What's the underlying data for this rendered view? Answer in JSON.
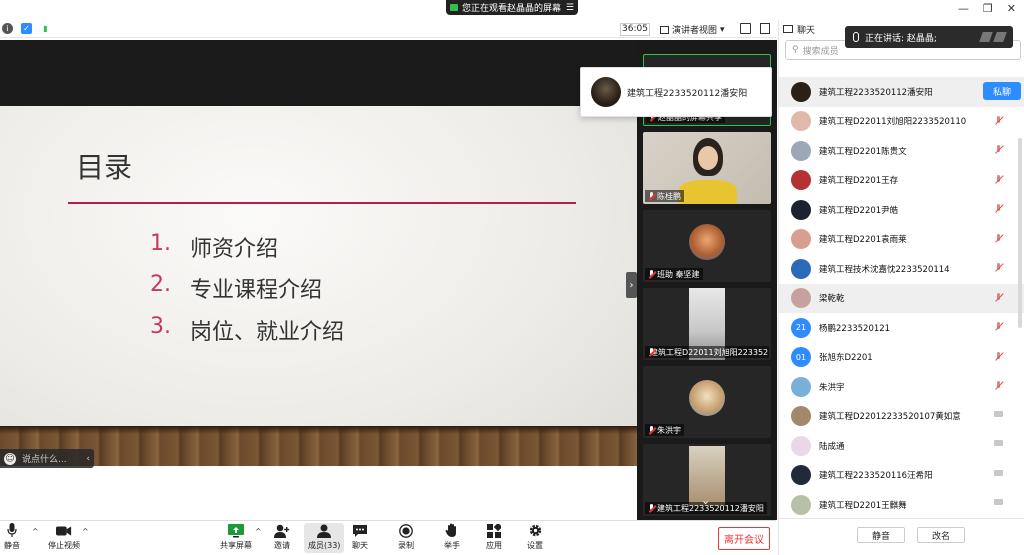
{
  "window": {
    "share_banner": "您正在观看赵晶晶的屏幕",
    "menu_glyph": "☰",
    "controls": [
      "—",
      "❐",
      "✕"
    ]
  },
  "topbar": {
    "timer": "36:05",
    "view_label": "演讲者视图",
    "view_caret": "▾"
  },
  "slide": {
    "title": "目录",
    "items": [
      {
        "num": "1.",
        "text": "师资介绍"
      },
      {
        "num": "2.",
        "text": "专业课程介绍"
      },
      {
        "num": "3.",
        "text": "岗位、就业介绍"
      }
    ]
  },
  "comment_bar": {
    "placeholder": "说点什么...",
    "chevron": "‹"
  },
  "collapse_handle": "›",
  "popup": {
    "name": "建筑工程2233520112潘安阳"
  },
  "video_tiles": [
    {
      "name": "赵晶晶的屏幕共享"
    },
    {
      "name": "陈桂鹏"
    },
    {
      "name": "班助 秦坚建"
    },
    {
      "name": "建筑工程D22011刘旭阳223352..."
    },
    {
      "name": "朱洪宇"
    },
    {
      "name": "建筑工程2233520112潘安阳"
    }
  ],
  "scroll_down": "⌄",
  "bottombar": {
    "mute": "静音",
    "stop_video": "停止视频",
    "share_screen": "共享屏幕",
    "invite": "邀请",
    "members": "成员(33)",
    "chat": "聊天",
    "record": "录制",
    "raise_hand": "举手",
    "apps": "应用",
    "settings": "设置",
    "leave": "离开会议",
    "caret": "^"
  },
  "panel": {
    "title": "聊天",
    "search_placeholder": "搜索成员",
    "search_icon": "⚲",
    "private_chat": "私聊",
    "mute_btn": "静音",
    "rename_btn": "改名",
    "members": [
      {
        "name": "建筑工程2233520112潘安阳",
        "avatar_color": "#2a2018",
        "avatar_text": "",
        "status": "pm"
      },
      {
        "name": "建筑工程D22011刘旭阳2233520110",
        "avatar_color": "#e0b9a8",
        "avatar_text": "",
        "status": "mic-off"
      },
      {
        "name": "建筑工程D2201陈贵文",
        "avatar_color": "#9aa8b8",
        "avatar_text": "",
        "status": "mic-off"
      },
      {
        "name": "建筑工程D2201王存",
        "avatar_color": "#b43232",
        "avatar_text": "",
        "status": "mic-off"
      },
      {
        "name": "建筑工程D2201尹皓",
        "avatar_color": "#1e2230",
        "avatar_text": "",
        "status": "mic-off"
      },
      {
        "name": "建筑工程D2201袁雨莱",
        "avatar_color": "#d6a090",
        "avatar_text": "",
        "status": "mic-off"
      },
      {
        "name": "建筑工程技术沈嘉忱2233520114",
        "avatar_color": "#2a6ab8",
        "avatar_text": "",
        "status": "mic-off"
      },
      {
        "name": "梁乾乾",
        "avatar_color": "#c8a0a0",
        "avatar_text": "",
        "status": "mic-off"
      },
      {
        "name": "杨鹏2233520121",
        "avatar_color": "#2d8cff",
        "avatar_text": "21",
        "status": "mic-off"
      },
      {
        "name": "张旭东D2201",
        "avatar_color": "#2d8cff",
        "avatar_text": "01",
        "status": "mic-off"
      },
      {
        "name": "朱洪宇",
        "avatar_color": "#7ab0d8",
        "avatar_text": "",
        "status": "mic-off"
      },
      {
        "name": "建筑工程D22012233520107黄如意",
        "avatar_color": "#a08868",
        "avatar_text": "",
        "status": "cam"
      },
      {
        "name": "陆成通",
        "avatar_color": "#e8d8e8",
        "avatar_text": "",
        "status": "cam"
      },
      {
        "name": "建筑工程2233520116汪希阳",
        "avatar_color": "#222a3a",
        "avatar_text": "",
        "status": "cam"
      },
      {
        "name": "建筑工程D2201王麒舞",
        "avatar_color": "#b8c0a8",
        "avatar_text": "",
        "status": "cam"
      }
    ]
  },
  "speaking": {
    "label": "正在讲话: 赵晶晶;"
  }
}
